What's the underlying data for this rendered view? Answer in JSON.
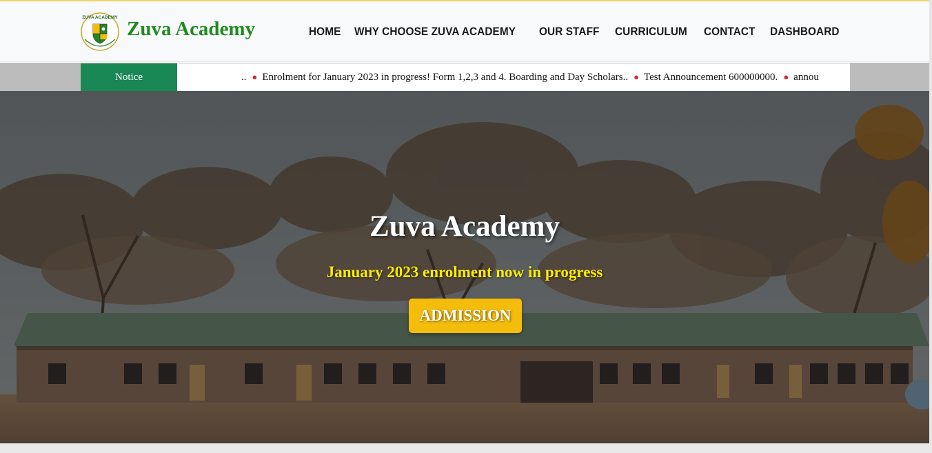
{
  "header": {
    "brand": "Zuva Academy",
    "logo_text": "ZUVA ACADEMY",
    "nav": [
      {
        "label": "HOME"
      },
      {
        "label": "WHY CHOOSE ZUVA ACADEMY"
      },
      {
        "label": "OUR STAFF"
      },
      {
        "label": "CURRICULUM"
      },
      {
        "label": "CONTACT"
      },
      {
        "label": "DASHBOARD"
      }
    ]
  },
  "notice": {
    "label": "Notice",
    "lead": "..",
    "items": [
      "Enrolment for January 2023 in progress! Form 1,2,3 and 4. Boarding and Day Scholars..",
      "Test Announcement 600000000.",
      "annou"
    ]
  },
  "hero": {
    "title": "Zuva Academy",
    "subtitle": "January 2023 enrolment now in progress",
    "cta": "ADMISSION"
  },
  "colors": {
    "brand_green": "#1f8a1f",
    "notice_green": "#198754",
    "accent_yellow": "#f4bc0b",
    "subtitle_yellow": "#ffeb00",
    "bullet_red": "#d92b2b"
  }
}
